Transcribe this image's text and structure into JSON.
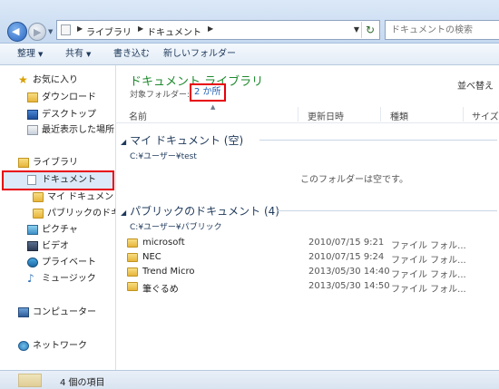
{
  "address": {
    "crumbs": [
      "ライブラリ",
      "ドキュメント"
    ],
    "search_placeholder": "ドキュメントの検索"
  },
  "toolbar": {
    "organize": "整理",
    "share": "共有",
    "burn": "書き込む",
    "new_folder": "新しいフォルダー"
  },
  "sidebar": {
    "favorites": "お気に入り",
    "downloads": "ダウンロード",
    "desktop": "デスクトップ",
    "recent": "最近表示した場所",
    "libraries": "ライブラリ",
    "documents": "ドキュメント",
    "my_documents": "マイ ドキュメント",
    "public_documents": "パブリックのドキュメント",
    "pictures": "ピクチャ",
    "videos": "ビデオ",
    "private": "プライベート",
    "music": "ミュージック",
    "computer": "コンピューター",
    "network": "ネットワーク"
  },
  "content": {
    "library_title": "ドキュメント ライブラリ",
    "target_label": "対象フォルダー:",
    "target_link": "2 か所",
    "arrange_label": "並べ替え",
    "columns": {
      "name": "名前",
      "modified": "更新日時",
      "type": "種類",
      "size": "サイズ"
    },
    "group1": {
      "title": "マイ ドキュメント (空)",
      "path": "C:¥ユーザー¥test",
      "empty_message": "このフォルダーは空です。"
    },
    "group2": {
      "title": "パブリックのドキュメント (4)",
      "path": "C:¥ユーザー¥パブリック",
      "rows": [
        {
          "name": "microsoft",
          "modified": "2010/07/15 9:21",
          "type": "ファイル フォル..."
        },
        {
          "name": "NEC",
          "modified": "2010/07/15 9:24",
          "type": "ファイル フォル..."
        },
        {
          "name": "Trend Micro",
          "modified": "2013/05/30 14:40",
          "type": "ファイル フォル..."
        },
        {
          "name": "筆ぐるめ",
          "modified": "2013/05/30 14:50",
          "type": "ファイル フォル..."
        }
      ]
    }
  },
  "status": {
    "item_count": "4 個の項目"
  },
  "colors": {
    "highlight": "#e8000b",
    "title_green": "#1e8a2e",
    "link_blue": "#1f5fb4"
  }
}
